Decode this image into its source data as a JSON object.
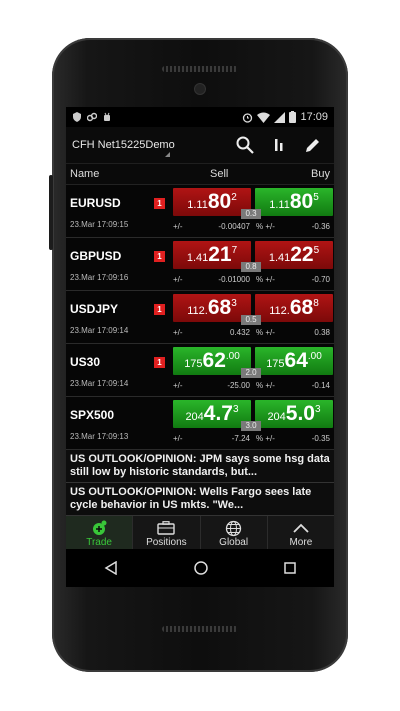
{
  "status_bar": {
    "time": "17:09",
    "left_icons": [
      "shield-icon",
      "link-icon",
      "android-icon"
    ],
    "right_icons": [
      "alarm-icon",
      "wifi-icon",
      "signal-icon",
      "battery-icon"
    ]
  },
  "toolbar": {
    "account": "CFH Net15225Demo",
    "icons": [
      "search-icon",
      "chart-icon",
      "edit-icon"
    ]
  },
  "columns": {
    "name": "Name",
    "sell": "Sell",
    "buy": "Buy"
  },
  "rows": [
    {
      "symbol": "EURUSD",
      "flag": "1",
      "time": "23.Mar 17:09:15",
      "sell": {
        "prefix": "1.11",
        "big": "80",
        "pip": "2",
        "color": "red"
      },
      "buy": {
        "prefix": "1.11",
        "big": "80",
        "pip": "5",
        "color": "green"
      },
      "spread": "0.3",
      "pm_label": "+/-",
      "change": "-0.00407",
      "pct_label": "% +/-",
      "pct_change": "-0.36"
    },
    {
      "symbol": "GBPUSD",
      "flag": "1",
      "time": "23.Mar 17:09:16",
      "sell": {
        "prefix": "1.41",
        "big": "21",
        "pip": "7",
        "color": "red"
      },
      "buy": {
        "prefix": "1.41",
        "big": "22",
        "pip": "5",
        "color": "red"
      },
      "spread": "0.8",
      "pm_label": "+/-",
      "change": "-0.01000",
      "pct_label": "% +/-",
      "pct_change": "-0.70"
    },
    {
      "symbol": "USDJPY",
      "flag": "1",
      "time": "23.Mar 17:09:14",
      "sell": {
        "prefix": "112.",
        "big": "68",
        "pip": "3",
        "color": "red"
      },
      "buy": {
        "prefix": "112.",
        "big": "68",
        "pip": "8",
        "color": "red"
      },
      "spread": "0.5",
      "pm_label": "+/-",
      "change": "0.432",
      "pct_label": "% +/-",
      "pct_change": "0.38"
    },
    {
      "symbol": "US30",
      "flag": "1",
      "time": "23.Mar 17:09:14",
      "sell": {
        "prefix": "175",
        "big": "62",
        "pip": ".00",
        "color": "green"
      },
      "buy": {
        "prefix": "175",
        "big": "64",
        "pip": ".00",
        "color": "green"
      },
      "spread": "2.0",
      "pm_label": "+/-",
      "change": "-25.00",
      "pct_label": "% +/-",
      "pct_change": "-0.14"
    },
    {
      "symbol": "SPX500",
      "flag": "",
      "time": "23.Mar 17:09:13",
      "sell": {
        "prefix": "204",
        "big": "4.7",
        "pip": "3",
        "color": "green"
      },
      "buy": {
        "prefix": "204",
        "big": "5.0",
        "pip": "3",
        "color": "green"
      },
      "spread": "3.0",
      "pm_label": "+/-",
      "change": "-7.24",
      "pct_label": "% +/-",
      "pct_change": "-0.35"
    }
  ],
  "news": [
    "US OUTLOOK/OPINION: JPM says some hsg data still low by historic standards, but...",
    "US OUTLOOK/OPINION: Wells Fargo sees late cycle behavior in US mkts. \"We..."
  ],
  "tabs": [
    {
      "label": "Trade",
      "icon": "trade-icon",
      "active": true
    },
    {
      "label": "Positions",
      "icon": "briefcase-icon",
      "active": false
    },
    {
      "label": "Global",
      "icon": "globe-icon",
      "active": false
    },
    {
      "label": "More",
      "icon": "chevron-up-icon",
      "active": false
    }
  ],
  "colors": {
    "sell_red": "#b01414",
    "buy_green": "#2ab52a",
    "active_tab": "#39c739"
  }
}
